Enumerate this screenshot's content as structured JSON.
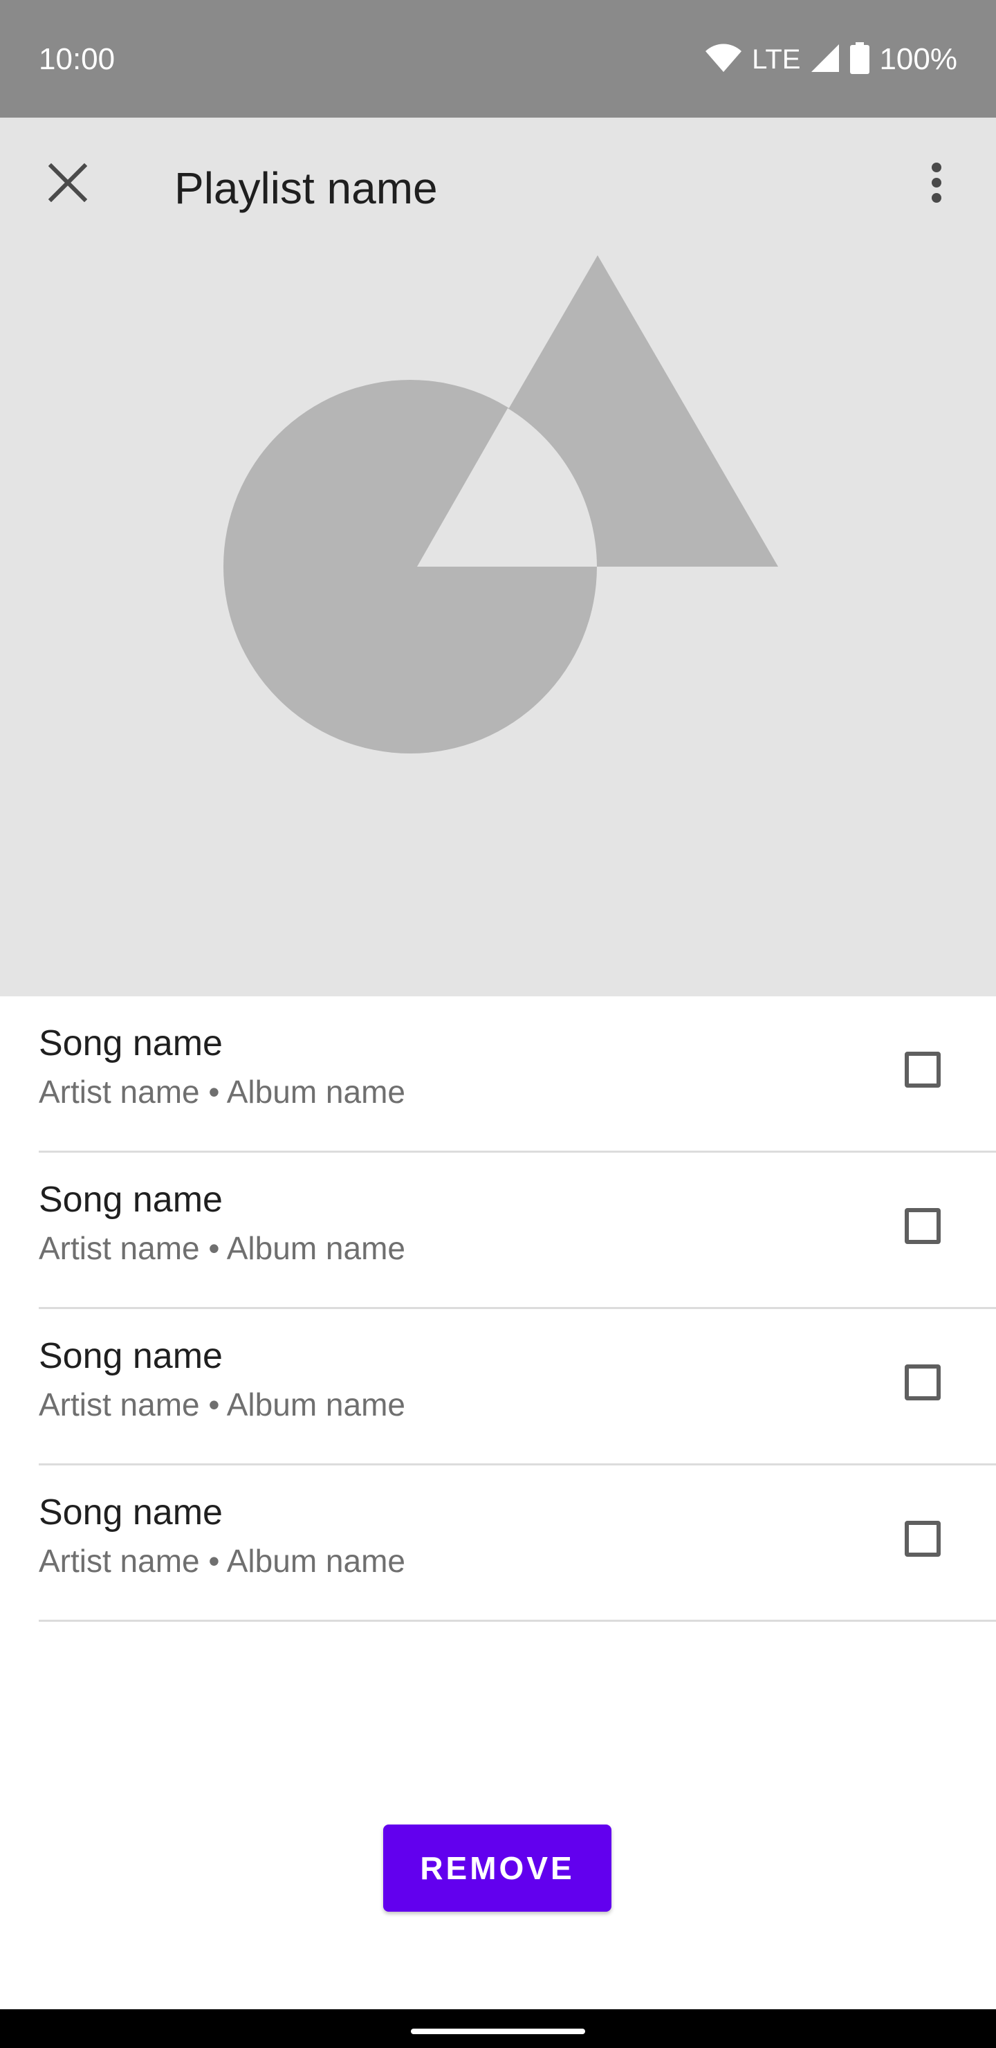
{
  "status_bar": {
    "time": "10:00",
    "network": "LTE",
    "battery": "100%",
    "icons": [
      "wifi-icon",
      "cellular-signal-icon",
      "battery-icon"
    ]
  },
  "app_bar": {
    "title": "Playlist name",
    "close_icon": "close-icon",
    "more_icon": "more-vert-icon"
  },
  "artwork": {
    "shape_color": "#b5b5b5",
    "background_color": "#e4e4e4"
  },
  "songs": [
    {
      "title": "Song name",
      "subtitle": "Artist name • Album name",
      "checked": false
    },
    {
      "title": "Song name",
      "subtitle": "Artist name • Album name",
      "checked": false
    },
    {
      "title": "Song name",
      "subtitle": "Artist name • Album name",
      "checked": false
    },
    {
      "title": "Song name",
      "subtitle": "Artist name • Album name",
      "checked": false
    }
  ],
  "actions": {
    "remove_label": "REMOVE"
  },
  "colors": {
    "accent": "#6200ee",
    "status_bar": "#8a8a8a"
  }
}
